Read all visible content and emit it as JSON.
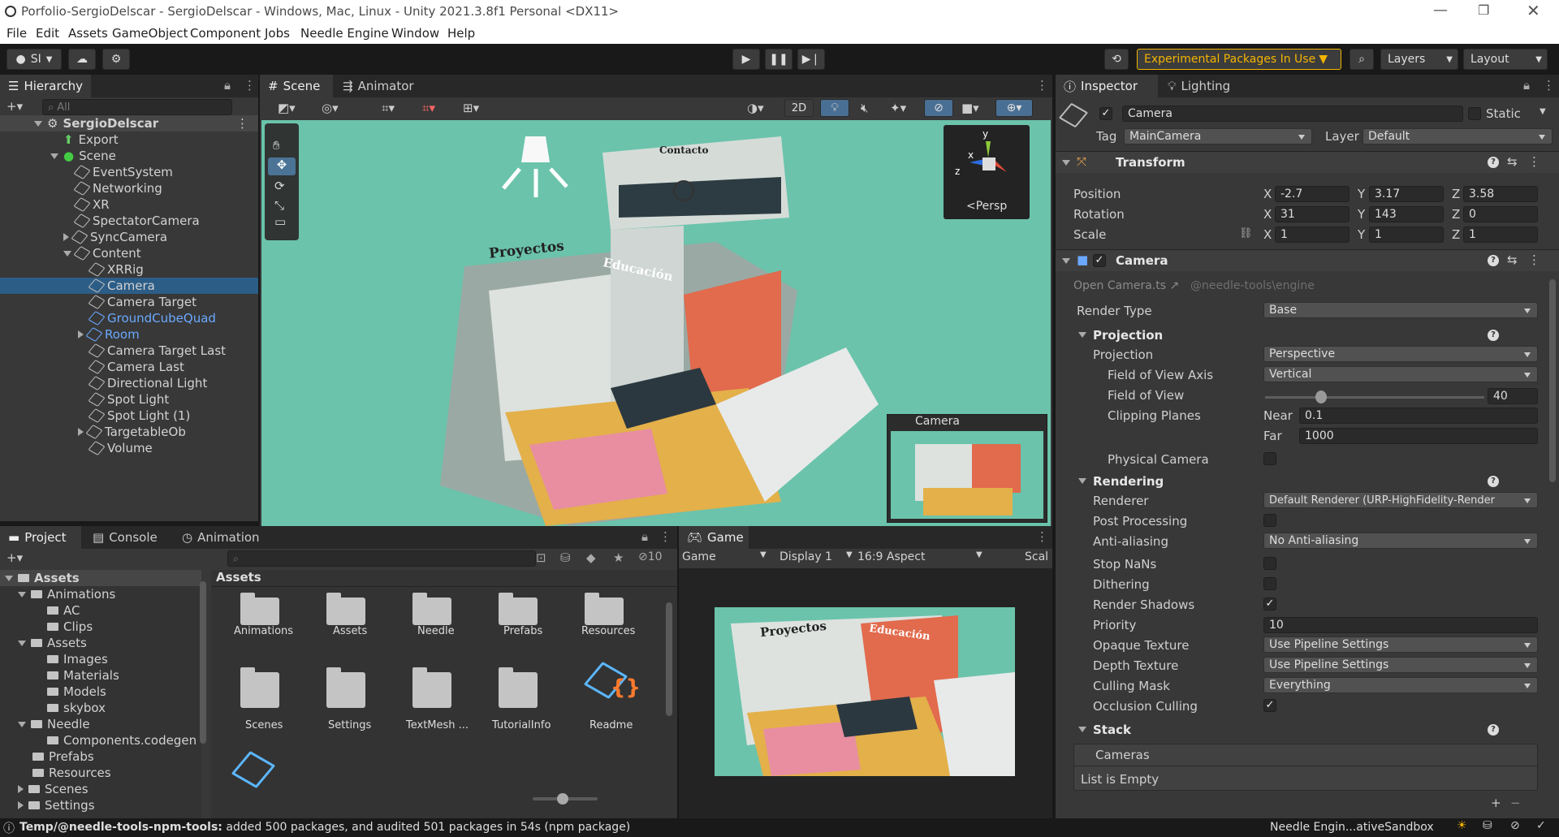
{
  "window": {
    "title": "Porfolio-SergioDelscar - SergioDelscar - Windows, Mac, Linux - Unity 2021.3.8f1 Personal <DX11>"
  },
  "menu": [
    "File",
    "Edit",
    "Assets",
    "GameObject",
    "Component",
    "Jobs",
    "Needle Engine",
    "Window",
    "Help"
  ],
  "toolbar": {
    "account": "SI",
    "experimental": "Experimental Packages In Use",
    "layers": "Layers",
    "layout": "Layout"
  },
  "hierarchy": {
    "tab": "Hierarchy",
    "search_placeholder": "All",
    "root": "SergioDelscar",
    "items": [
      {
        "label": "Export"
      },
      {
        "label": "Scene"
      },
      {
        "label": "EventSystem"
      },
      {
        "label": "Networking"
      },
      {
        "label": "XR"
      },
      {
        "label": "SpectatorCamera"
      },
      {
        "label": "SyncCamera"
      },
      {
        "label": "Content"
      },
      {
        "label": "XRRig"
      },
      {
        "label": "Camera"
      },
      {
        "label": "Camera Target"
      },
      {
        "label": "GroundCubeQuad"
      },
      {
        "label": "Room"
      },
      {
        "label": "Camera Target Last"
      },
      {
        "label": "Camera Last"
      },
      {
        "label": "Directional Light"
      },
      {
        "label": "Spot Light"
      },
      {
        "label": "Spot Light (1)"
      },
      {
        "label": "TargetableOb"
      },
      {
        "label": "Volume"
      }
    ]
  },
  "scene": {
    "tabs": [
      "Scene",
      "Animator"
    ],
    "mode_2d": "2D",
    "gizmo_label": "Persp",
    "gizmo_axes": [
      "y",
      "x",
      "z"
    ],
    "preview_label": "Camera",
    "scene_texts": [
      "Proyectos",
      "Educación",
      "Contacto"
    ]
  },
  "inspector": {
    "tabs": [
      "Inspector",
      "Lighting"
    ],
    "object_name": "Camera",
    "static_label": "Static",
    "tag_label": "Tag",
    "tag_value": "MainCamera",
    "layer_label": "Layer",
    "layer_value": "Default",
    "transform": {
      "title": "Transform",
      "position_label": "Position",
      "rotation_label": "Rotation",
      "scale_label": "Scale",
      "position": [
        "-2.7",
        "3.17",
        "3.58"
      ],
      "rotation": [
        "31",
        "143",
        "0"
      ],
      "scale": [
        "1",
        "1",
        "1"
      ],
      "axes": [
        "X",
        "Y",
        "Z"
      ]
    },
    "camera": {
      "title": "Camera",
      "open_link": "Open Camera.ts ↗",
      "package": "@needle-tools\\engine",
      "render_type_label": "Render Type",
      "render_type": "Base",
      "projection_header": "Projection",
      "projection_label": "Projection",
      "projection": "Perspective",
      "fov_axis_label": "Field of View Axis",
      "fov_axis": "Vertical",
      "fov_label": "Field of View",
      "fov": "40",
      "clipping_label": "Clipping Planes",
      "near_label": "Near",
      "near": "0.1",
      "far_label": "Far",
      "far": "1000",
      "physical_label": "Physical Camera",
      "rendering_header": "Rendering",
      "renderer_label": "Renderer",
      "renderer": "Default Renderer (URP-HighFidelity-Render",
      "post_label": "Post Processing",
      "aa_label": "Anti-aliasing",
      "aa": "No Anti-aliasing",
      "stopnan_label": "Stop NaNs",
      "dither_label": "Dithering",
      "shadows_label": "Render Shadows",
      "priority_label": "Priority",
      "priority": "10",
      "opaque_label": "Opaque Texture",
      "opaque": "Use Pipeline Settings",
      "depth_label": "Depth Texture",
      "depth": "Use Pipeline Settings",
      "culling_label": "Culling Mask",
      "culling": "Everything",
      "occlusion_label": "Occlusion Culling",
      "stack_header": "Stack",
      "cameras_label": "Cameras",
      "empty_label": "List is Empty"
    }
  },
  "project": {
    "tabs": [
      "Project",
      "Console",
      "Animation"
    ],
    "hidden_count": "10",
    "breadcrumb": "Assets",
    "tree": [
      {
        "label": "Assets"
      },
      {
        "label": "Animations"
      },
      {
        "label": "AC"
      },
      {
        "label": "Clips"
      },
      {
        "label": "Assets"
      },
      {
        "label": "Images"
      },
      {
        "label": "Materials"
      },
      {
        "label": "Models"
      },
      {
        "label": "skybox"
      },
      {
        "label": "Needle"
      },
      {
        "label": "Components.codegen"
      },
      {
        "label": "Prefabs"
      },
      {
        "label": "Resources"
      },
      {
        "label": "Scenes"
      },
      {
        "label": "Settings"
      }
    ],
    "grid_row1": [
      "Animations",
      "Assets",
      "Needle",
      "Prefabs",
      "Resources"
    ],
    "grid_row2": [
      "Scenes",
      "Settings",
      "TextMesh ...",
      "TutorialInfo",
      "Readme"
    ]
  },
  "game": {
    "tab": "Game",
    "mode": "Game",
    "display": "Display 1",
    "aspect": "16:9 Aspect",
    "scale": "Scal"
  },
  "status": {
    "path": "Temp/@needle-tools-npm-tools:",
    "message": " added 500 packages, and audited 501 packages in 54s (npm package)",
    "sandbox": "Needle Engin...ativeSandbox"
  },
  "colors": {
    "accent": "#2c5d87",
    "warning": "#f4b400",
    "link_blue": "#6aa9ff"
  }
}
